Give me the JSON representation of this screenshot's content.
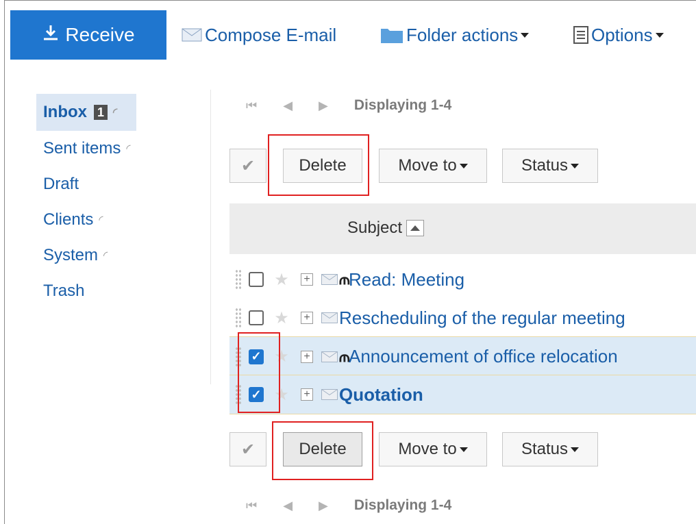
{
  "toolbar": {
    "receive_label": "Receive",
    "compose_label": "Compose E-mail",
    "folder_actions_label": "Folder actions",
    "options_label": "Options"
  },
  "sidebar": {
    "items": [
      {
        "label": "Inbox",
        "badge": "1"
      },
      {
        "label": "Sent items"
      },
      {
        "label": "Draft"
      },
      {
        "label": "Clients"
      },
      {
        "label": "System"
      },
      {
        "label": "Trash"
      }
    ]
  },
  "pager": {
    "top_text": "Displaying 1-4",
    "bottom_text": "Displaying 1-4"
  },
  "actions": {
    "delete_label": "Delete",
    "move_label": "Move to",
    "status_label": "Status"
  },
  "list": {
    "subject_header": "Subject",
    "rows": [
      {
        "subject": "Read: Meeting",
        "checked": false,
        "attachment": true,
        "unread": false
      },
      {
        "subject": "Rescheduling of the regular meeting",
        "checked": false,
        "attachment": false,
        "unread": false
      },
      {
        "subject": "Announcement of office relocation",
        "checked": true,
        "attachment": true,
        "unread": false
      },
      {
        "subject": "Quotation",
        "checked": true,
        "attachment": false,
        "unread": true
      }
    ]
  },
  "colors": {
    "accent": "#1f76cf",
    "link": "#1a5ea8",
    "highlight": "#e02020",
    "selected_row": "#dceaf6"
  }
}
